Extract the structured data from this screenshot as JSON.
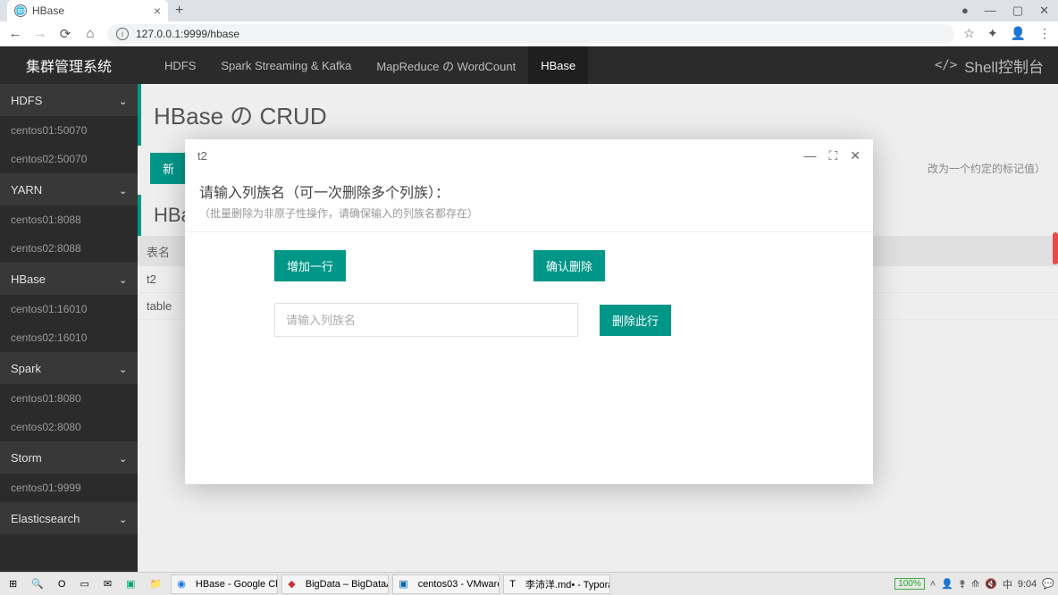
{
  "browser": {
    "tab_title": "HBase",
    "url": "127.0.0.1:9999/hbase"
  },
  "sidebar": {
    "brand": "集群管理系统",
    "groups": [
      {
        "label": "HDFS",
        "items": [
          "centos01:50070",
          "centos02:50070"
        ]
      },
      {
        "label": "YARN",
        "items": [
          "centos01:8088",
          "centos02:8088"
        ]
      },
      {
        "label": "HBase",
        "items": [
          "centos01:16010",
          "centos02:16010"
        ]
      },
      {
        "label": "Spark",
        "items": [
          "centos01:8080",
          "centos02:8080"
        ]
      },
      {
        "label": "Storm",
        "items": [
          "centos01:9999"
        ]
      },
      {
        "label": "Elasticsearch",
        "items": []
      }
    ]
  },
  "topnav": {
    "items": [
      "HDFS",
      "Spark Streaming & Kafka",
      "MapReduce の WordCount",
      "HBase"
    ],
    "active_index": 3,
    "shell_label": "Shell控制台"
  },
  "page": {
    "title": "HBase の CRUD",
    "toolbar": {
      "new_btn": "新",
      "hint_right": "改为一个约定的标记值）"
    },
    "subtitle": "HBa",
    "table": {
      "header": "表名",
      "rows": [
        "t2",
        "table"
      ]
    }
  },
  "modal": {
    "title": "t2",
    "prompt_main": "请输入列族名（可一次删除多个列族）：",
    "prompt_sub": "（批量删除为非原子性操作，请确保输入的列族名都存在）",
    "add_row_btn": "增加一行",
    "confirm_btn": "确认删除",
    "input_placeholder": "请输入列族名",
    "delete_row_btn": "删除此行"
  },
  "taskbar": {
    "tasks": [
      "HBase - Google Chr…",
      "BigData – BigDataA…",
      "centos03 - VMware…",
      "李沛洋.md• - Typora"
    ],
    "battery": "100%",
    "ime": "中",
    "time": "9:04"
  }
}
